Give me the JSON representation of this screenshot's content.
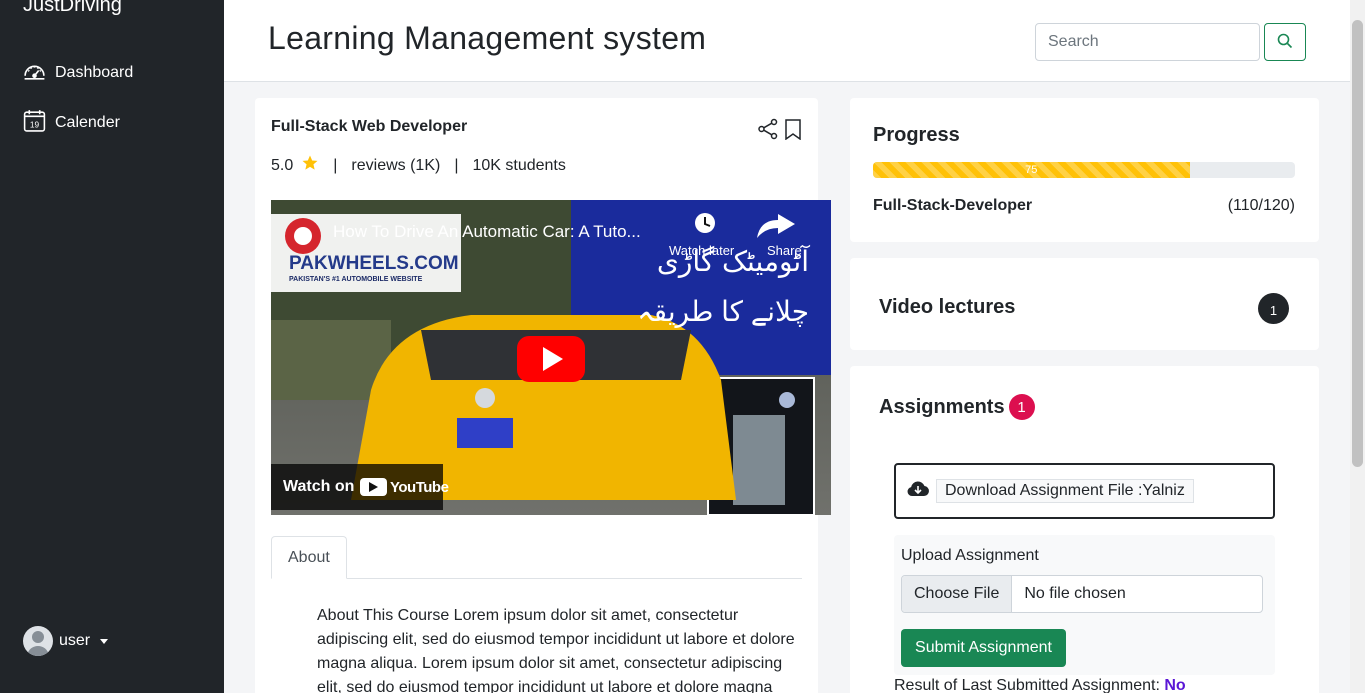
{
  "sidebar": {
    "brand": "JustDriving",
    "items": [
      {
        "label": "Dashboard",
        "icon": "speedometer-icon"
      },
      {
        "label": "Calender",
        "icon": "calendar-icon",
        "icon_text": "19"
      }
    ],
    "user": {
      "name": "user"
    }
  },
  "header": {
    "title": "Learning Management system",
    "search_placeholder": "Search"
  },
  "course": {
    "title": "Full-Stack Web Developer",
    "rating": "5.0",
    "reviews": "reviews (1K)",
    "students": "10K students",
    "video": {
      "title": "How To Drive An Automatic Car: A Tuto...",
      "watch_later": "Watch later",
      "share": "Share",
      "watch_on": "Watch on",
      "youtube": "YouTube",
      "channel_logo": "PAKWHEELS.COM",
      "channel_tagline": "PAKISTAN'S #1 AUTOMOBILE WEBSITE",
      "urdu_line1": "آٹومیٹک گاڑی",
      "urdu_line2": "چلانے کا طریقہ"
    },
    "tabs": [
      {
        "label": "About"
      }
    ],
    "about": "About This Course Lorem ipsum dolor sit amet, consectetur adipiscing elit, sed do eiusmod tempor incididunt ut labore et dolore magna aliqua. Lorem ipsum dolor sit amet, consectetur adipiscing elit, sed do eiusmod tempor incididunt ut labore et dolore magna"
  },
  "progress": {
    "title": "Progress",
    "percent": 75,
    "percent_label": "75",
    "course_name": "Full-Stack-Developer",
    "count": "(110/120)",
    "color": "#ffc107"
  },
  "video_lectures": {
    "title": "Video lectures",
    "count": "1"
  },
  "assignments": {
    "title": "Assignments",
    "count": "1",
    "download_label": "Download Assignment File :Yalniz",
    "upload_label": "Upload Assignment",
    "choose_file": "Choose File",
    "no_file": "No file chosen",
    "submit_label": "Submit Assignment",
    "result_label": "Result of Last Submitted Assignment:",
    "result_value": "No"
  },
  "colors": {
    "sidebar_bg": "#212529",
    "success": "#198754",
    "badge_red": "#dc0f4f",
    "result_purple": "#5a16d6"
  }
}
